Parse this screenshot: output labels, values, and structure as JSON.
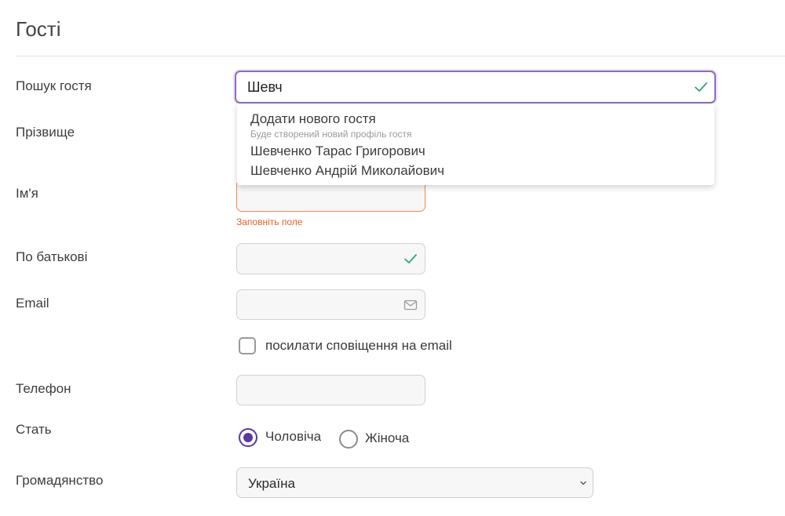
{
  "page": {
    "title": "Гості"
  },
  "labels": {
    "search": "Пошук гостя",
    "surname": "Прізвище",
    "first_name": "Ім'я",
    "patronymic": "По батькові",
    "email": "Email",
    "phone": "Телефон",
    "gender": "Стать",
    "citizenship": "Громадянство"
  },
  "search": {
    "value": "Шевч"
  },
  "dropdown": {
    "add_new": "Додати нового гостя",
    "add_new_hint": "Буде створений новий профіль гостя",
    "results": [
      "Шевченко Тарас Григорович",
      "Шевченко Андрій Миколайович"
    ]
  },
  "first_name_field": {
    "value": "",
    "error": "Заповніть поле"
  },
  "patronymic_field": {
    "value": ""
  },
  "email_field": {
    "value": ""
  },
  "notify": {
    "label": "посилати сповіщення на email",
    "checked": false
  },
  "phone_field": {
    "value": ""
  },
  "gender": {
    "options": [
      "Чоловіча",
      "Жіноча"
    ],
    "selected": "Чоловіча"
  },
  "citizenship": {
    "selected": "Україна"
  },
  "colors": {
    "accent": "#5a3a9e",
    "error": "#e2622a",
    "valid": "#2fa383"
  }
}
